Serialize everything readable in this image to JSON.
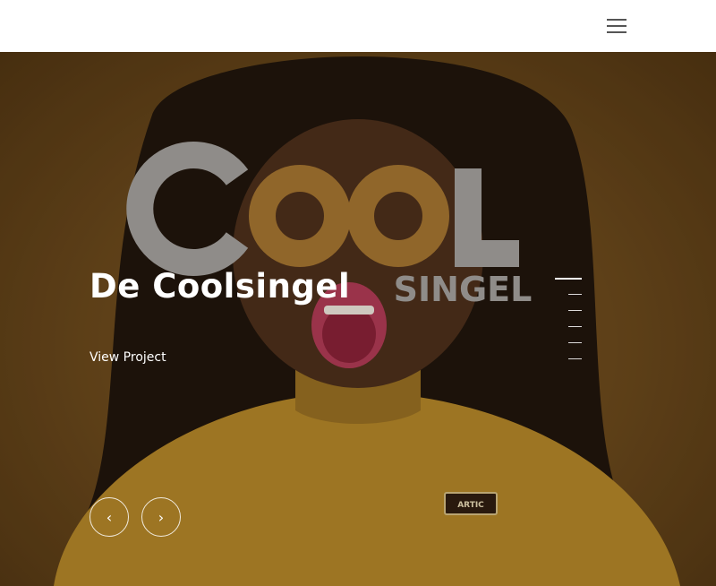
{
  "header": {
    "menu_icon": "hamburger-menu-icon"
  },
  "hero": {
    "logo_text": "COOL",
    "logo_subtext": "SINGEL",
    "badge_text": "ARTIC",
    "slide_title": "De Coolsingel",
    "link_label": "View Project",
    "slide_count": 6,
    "active_slide": 1,
    "prev_icon": "chevron-left-icon",
    "next_icon": "chevron-right-icon",
    "prev_glyph": "‹",
    "next_glyph": "›"
  },
  "colors": {
    "overlay": "#6b4a1d",
    "logo_gray": "#a7a7a7",
    "logo_gold": "#a87832",
    "sweater": "#b88a2a",
    "skin": "#4a2e1c"
  }
}
